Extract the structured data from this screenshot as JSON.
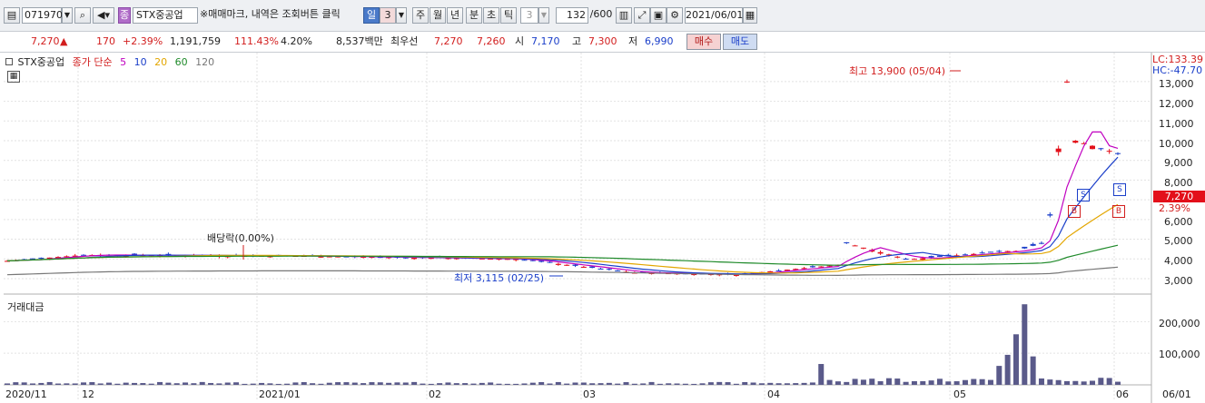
{
  "toolbar": {
    "code": "071970",
    "name_badge": "종",
    "stock_name": "STX중공업",
    "hint": "※매매마크, 내역은 조회버튼 클릭",
    "period_day": "일",
    "period_num": "3",
    "period_week": "주",
    "period_month": "월",
    "period_year": "년",
    "period_minute": "분",
    "period_second": "초",
    "period_tick": "틱",
    "tick_num": "3",
    "count": "132",
    "count_total": "/600",
    "date": "2021/06/01",
    "icons": {
      "code_menu": "code-list-icon",
      "search": "search-icon",
      "sound": "speaker-icon",
      "tools": "chart-tools-icon",
      "save": "save-icon",
      "settings": "gear-icon",
      "calendar": "calendar-icon"
    }
  },
  "quote": {
    "price": "7,270",
    "arrow": "▲",
    "change": "170",
    "change_pct": "+2.39%",
    "volume": "1,191,759",
    "volume_ratio": "111.43%",
    "turnover_pct": "4.20%",
    "amount": "8,537백만",
    "priority_label": "최우선",
    "ask": "7,270",
    "bid": "7,260",
    "open_label": "시",
    "open": "7,170",
    "high_label": "고",
    "high": "7,300",
    "low_label": "저",
    "low": "6,990",
    "buy_label": "매수",
    "sell_label": "매도",
    "colors": {
      "up": "#d21e1e",
      "down": "#1a3ec9",
      "buy_bg": "#f6d2d2",
      "sell_bg": "#cfdcf2"
    }
  },
  "chart": {
    "legend": {
      "name": "STX중공업",
      "label": "종가 단순",
      "ma": [
        {
          "period": "5",
          "color": "#c000c0"
        },
        {
          "period": "10",
          "color": "#1a3ec9"
        },
        {
          "period": "20",
          "color": "#e3a600"
        },
        {
          "period": "60",
          "color": "#1f8a2a"
        },
        {
          "period": "120",
          "color": "#777777"
        }
      ]
    },
    "lc": "LC:133.39",
    "hc": "HC:-47.70",
    "current_price_tag": "7,270",
    "current_pct_tag": "2.39%",
    "high_note": "최고 13,900 (05/04)",
    "low_note": "최저 3,115 (02/25)",
    "dividend_note": "배당락(0.00%)",
    "trade_marks": {
      "sell": "S",
      "buy": "B"
    },
    "volume_label": "거래대금",
    "price_ticks": [
      "13,000",
      "12,000",
      "11,000",
      "10,000",
      "9,000",
      "8,000",
      "7,000",
      "6,000",
      "5,000",
      "4,000",
      "3,000"
    ],
    "volume_ticks": [
      "200,000",
      "100,000"
    ],
    "x_labels": [
      "2020/11",
      "12",
      "2021/01",
      "02",
      "03",
      "04",
      "05",
      "06",
      "06/01"
    ]
  },
  "chart_data": {
    "type": "candlestick",
    "x_range": [
      "2020/11",
      "2021/06/01"
    ],
    "y_range": [
      2400,
      14100
    ],
    "series_hint": "daily candles with MA5/10/20/60/120 and traded amount",
    "events": {
      "high": 13900,
      "high_date": "05/04",
      "low": 3115,
      "low_date": "02/25",
      "last": 7270
    },
    "volume_y_range": [
      0,
      270000
    ]
  }
}
